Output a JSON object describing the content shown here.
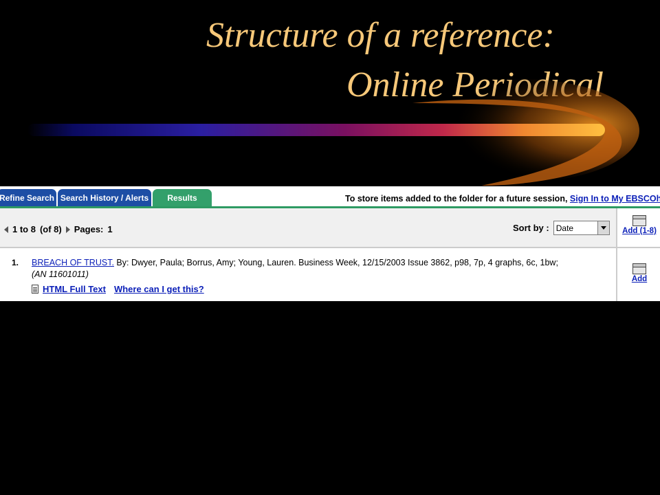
{
  "slide": {
    "title_line1": "Structure of a reference:",
    "title_line2": "Online Periodical",
    "title_color": "#f7c879"
  },
  "tabs": [
    {
      "label": "Refine Search",
      "color": "#1d4ea5"
    },
    {
      "label": "Search History / Alerts",
      "color": "#1d4ea5"
    },
    {
      "label": "Results",
      "color": "#33a06b",
      "active": true
    }
  ],
  "store_notice": {
    "text": "To store items added to the folder for a future session,",
    "link": "Sign In to My EBSCOhost"
  },
  "navigation": {
    "range": "1 to 8",
    "total": "(of 8)",
    "pages_label": "Pages:",
    "pages": "1"
  },
  "sort": {
    "label": "Sort by :",
    "selected": "Date"
  },
  "folder": {
    "add_all_label": "Add (1-8)",
    "add_label": "Add"
  },
  "results": [
    {
      "number": "1.",
      "title": "BREACH OF TRUST.",
      "citation_text": "By: Dwyer, Paula; Borrus, Amy; Young, Lauren. Business Week, 12/15/2003 Issue 3862, p98, 7p, 4 graphs, 6c, 1bw;",
      "accession": "(AN 11601011)",
      "full_text_label": "HTML Full Text",
      "where_label": "Where can I get this?"
    }
  ],
  "icons": [
    "arrow-left-icon",
    "arrow-right-icon",
    "folder-icon",
    "document-icon",
    "dropdown-arrow-icon"
  ]
}
